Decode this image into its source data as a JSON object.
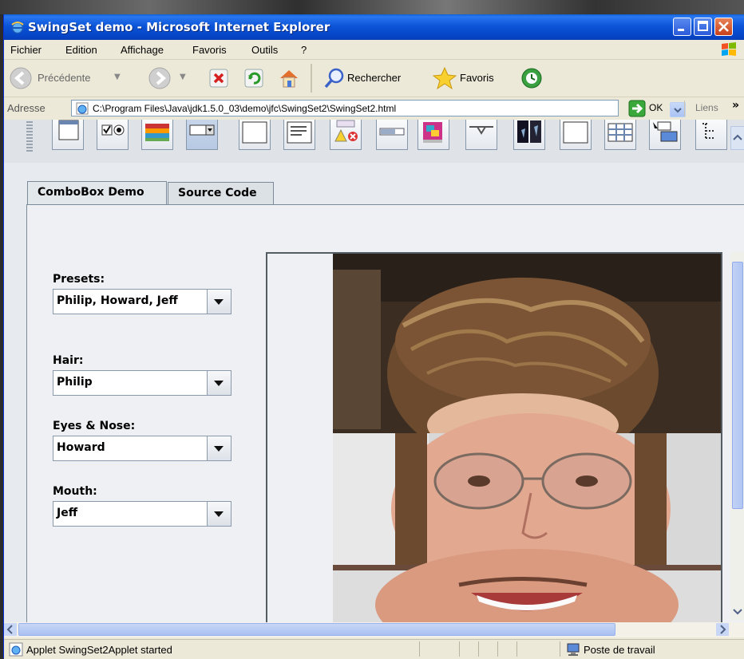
{
  "window": {
    "title": "SwingSet demo - Microsoft Internet Explorer"
  },
  "menu": {
    "items": [
      "Fichier",
      "Edition",
      "Affichage",
      "Favoris",
      "Outils",
      "?"
    ]
  },
  "toolbar": {
    "back_label": "Précédente",
    "search_label": "Rechercher",
    "favorites_label": "Favoris"
  },
  "address": {
    "label": "Adresse",
    "url": "C:\\Program Files\\Java\\jdk1.5.0_03\\demo\\jfc\\SwingSet2\\SwingSet2.html",
    "go_label": "OK",
    "links_label": "Liens",
    "chevron": "»"
  },
  "tabs": [
    {
      "label": "ComboBox Demo",
      "selected": true
    },
    {
      "label": "Source Code",
      "selected": false
    }
  ],
  "combo_demo": {
    "presets_label": "Presets:",
    "presets_value": "Philip, Howard, Jeff",
    "hair_label": "Hair:",
    "hair_value": "Philip",
    "eyes_label": "Eyes & Nose:",
    "eyes_value": "Howard",
    "mouth_label": "Mouth:",
    "mouth_value": "Jeff"
  },
  "status": {
    "text": "Applet SwingSet2Applet started",
    "zone": "Poste de travail"
  },
  "colors": {
    "titlebar": "#0b54d8",
    "chrome": "#ece9d8",
    "applet_bg": "#e7eaee"
  }
}
